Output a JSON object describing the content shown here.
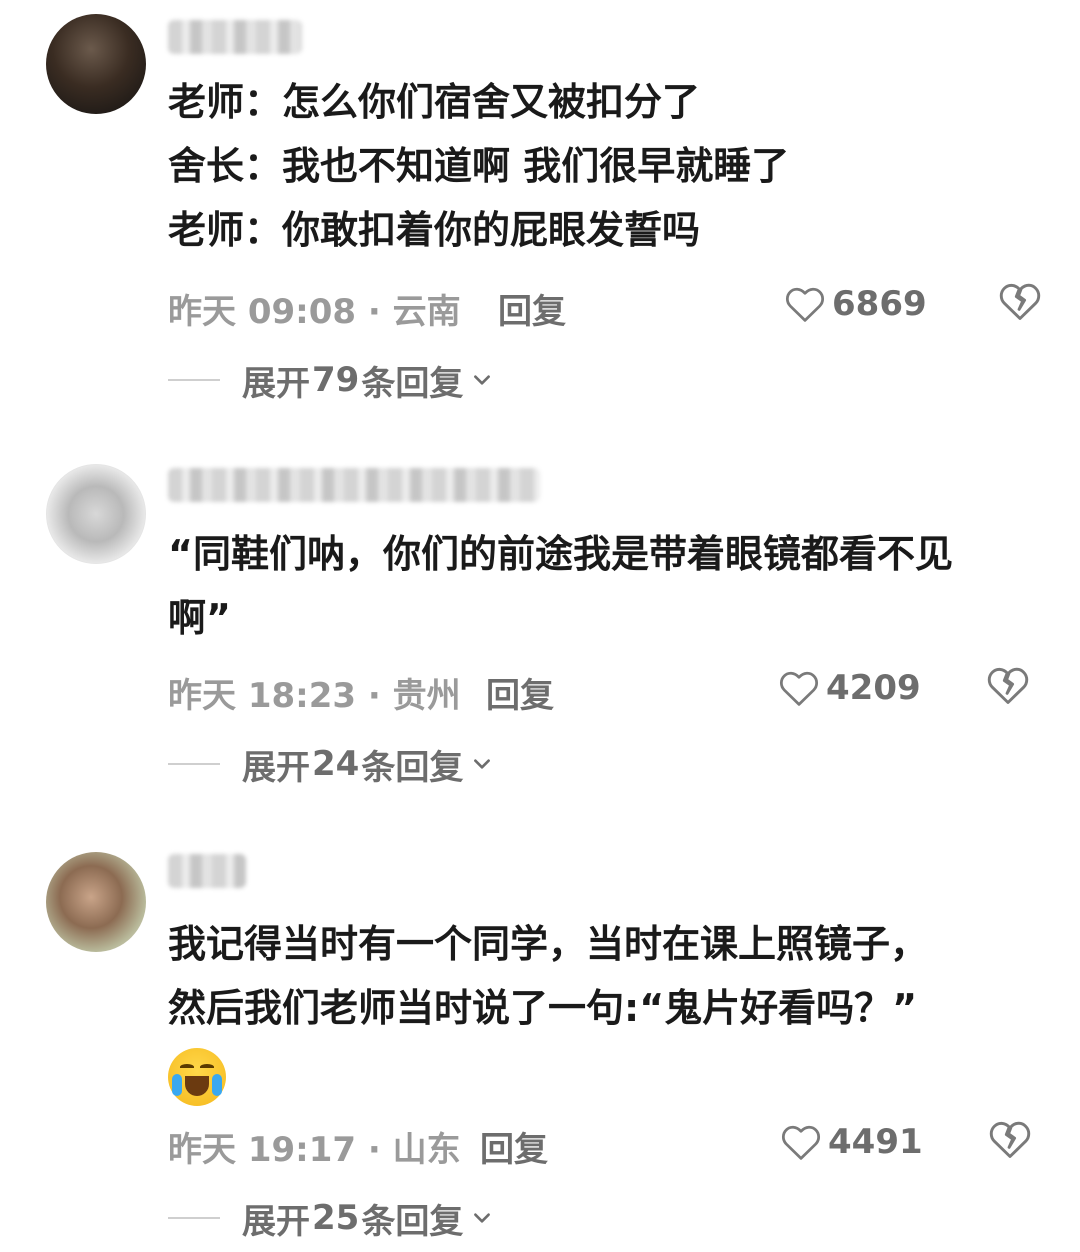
{
  "comments": [
    {
      "lines": [
        "老师：怎么你们宿舍又被扣分了",
        "舍长：我也不知道啊 我们很早就睡了",
        "老师：你敢扣着你的屁眼发誓吗"
      ],
      "time": "昨天 09:08 · 云南",
      "reply_label": "回复",
      "likes": "6869",
      "expand_prefix": "展开",
      "expand_count": "79",
      "expand_suffix": "条回复"
    },
    {
      "lines": [
        "“同鞋们呐，你们的前途我是带着眼镜都看不见",
        "啊”"
      ],
      "time": "昨天 18:23 · 贵州",
      "reply_label": "回复",
      "likes": "4209",
      "expand_prefix": "展开",
      "expand_count": "24",
      "expand_suffix": "条回复"
    },
    {
      "lines": [
        "我记得当时有一个同学，当时在课上照镜子，",
        "然后我们老师当时说了一句:“鬼片好看吗？”"
      ],
      "emoji": "loudly-crying-face-icon",
      "time": "昨天 19:17 · 山东",
      "reply_label": "回复",
      "likes": "4491",
      "expand_prefix": "展开",
      "expand_count": "25",
      "expand_suffix": "条回复"
    }
  ],
  "colors": {
    "text": "#1a1a1a",
    "meta": "#9a9a9a",
    "action": "#6d6d6d"
  }
}
